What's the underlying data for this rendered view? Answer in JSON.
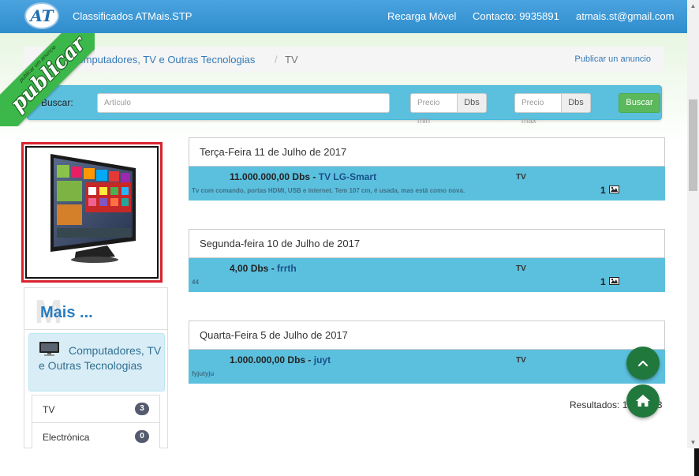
{
  "nav": {
    "logo_text": "AT",
    "brand": "Classificados ATMais.STP",
    "links": [
      "Recarga Móvel",
      "Contacto: 9935891",
      "atmais.st@gmail.com"
    ]
  },
  "ribbon": {
    "small": "publicar um anuncio",
    "big": "publicar"
  },
  "breadcrumb": {
    "category": "Computadores, TV e Outras Tecnologias",
    "separator": "/",
    "current": "TV",
    "publish_link": "Publicar un anuncio"
  },
  "search": {
    "label": "Buscar:",
    "article_placeholder": "Artículo",
    "price_min_placeholder": "Precio min",
    "price_max_placeholder": "Precio max",
    "currency": "Dbs",
    "button": "Buscar"
  },
  "sidebar": {
    "mais_shadow": "M",
    "mais_title": "Mais ...",
    "category_title": "Computadores, TV e Outras Tecnologias",
    "items": [
      {
        "label": "TV",
        "count": "3"
      },
      {
        "label": "Electrónica",
        "count": "0"
      }
    ]
  },
  "days": [
    {
      "date": "Terça-Feira 11 de Julho de 2017",
      "listing": {
        "price": "11.000.000,00 Dbs - ",
        "title": "TV LG-Smart",
        "category": "TV",
        "description": "Tv com comando, portas HDMI, USB e internet. Tem 107 cm, é usada, mas está como nova.",
        "image_count": "1"
      }
    },
    {
      "date": "Segunda-feira 10 de Julho de 2017",
      "listing": {
        "price": "4,00 Dbs - ",
        "title": "frrth",
        "category": "TV",
        "description": "44",
        "image_count": "1"
      }
    },
    {
      "date": "Quarta-Feira 5 de Julho de 2017",
      "listing": {
        "price": "1.000.000,00 Dbs - ",
        "title": "juyt",
        "category": "TV",
        "description": "fyjutyju",
        "image_count": ""
      }
    }
  ],
  "results": "Resultados: 1 - 3 de 3",
  "icons": {
    "scroll_top": "chevron-up-icon",
    "home": "home-icon",
    "image": "image-icon",
    "monitor": "monitor-icon"
  },
  "colors": {
    "navbar": "#3a97d6",
    "listing_bg": "#5bc0de",
    "buscar_button": "#5cb85c",
    "fab": "#21783d",
    "ribbon": "#3cb84a",
    "ad_border": "#d9232d"
  }
}
